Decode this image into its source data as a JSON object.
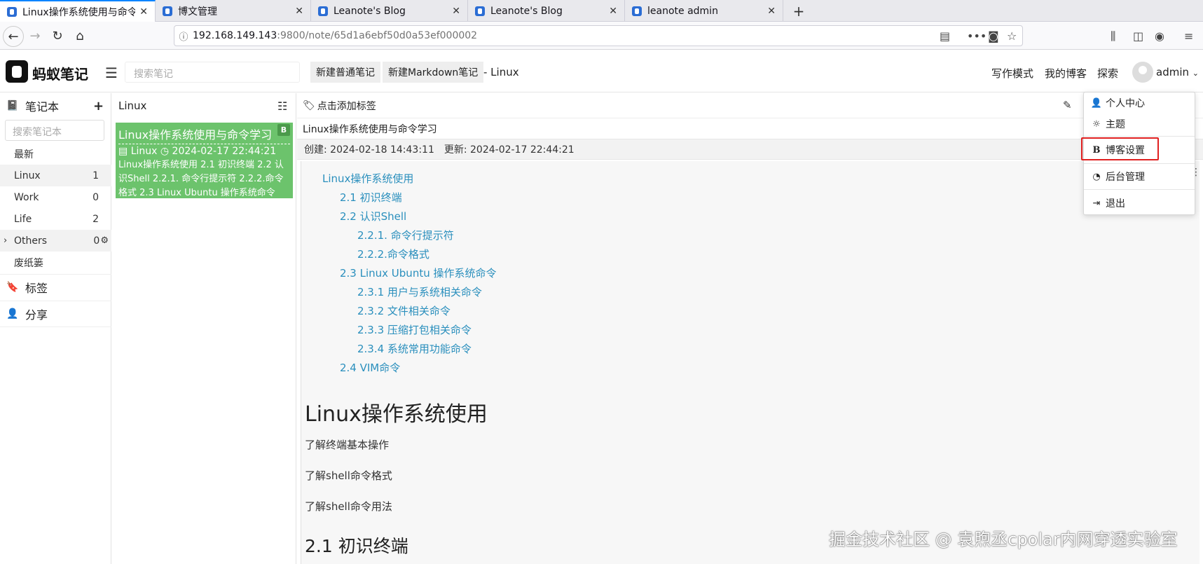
{
  "browser": {
    "tabs": [
      {
        "label": "Linux操作系统使用与命令学习",
        "active": true
      },
      {
        "label": "博文管理",
        "active": false
      },
      {
        "label": "Leanote's Blog",
        "active": false
      },
      {
        "label": "Leanote's Blog",
        "active": false
      },
      {
        "label": "leanote admin",
        "active": false
      }
    ],
    "url_host": "192.168.149.143",
    "url_path": ":9800/note/65d1a6ebf50d0a53ef000002"
  },
  "header": {
    "logo_text": "蚂蚁笔记",
    "search_placeholder": "搜索笔记",
    "new_note": "新建普通笔记",
    "new_markdown": "新建Markdown笔记",
    "current_notebook": "- Linux",
    "links": [
      "写作模式",
      "我的博客",
      "探索"
    ],
    "username": "admin"
  },
  "sidebar": {
    "notebooks_title": "笔记本",
    "search_placeholder": "搜索笔记本",
    "items": [
      {
        "label": "最新",
        "count": ""
      },
      {
        "label": "Linux",
        "count": "1"
      },
      {
        "label": "Work",
        "count": "0"
      },
      {
        "label": "Life",
        "count": "2"
      },
      {
        "label": "Others",
        "count": "0"
      },
      {
        "label": "废纸篓",
        "count": ""
      }
    ],
    "tags_title": "标签",
    "share_title": "分享"
  },
  "notelist": {
    "title": "Linux",
    "note": {
      "title": "Linux操作系统使用与命令学习",
      "notebook": "Linux",
      "time": "2024-02-17 22:44:21",
      "desc": "Linux操作系统使用 2.1 初识终端 2.2 认识Shell 2.2.1. 命令行提示符 2.2.2.命令格式 2.3 Linux Ubuntu 操作系统命令",
      "badge": "B"
    }
  },
  "editor": {
    "add_tag": "点击添加标签",
    "title": "Linux操作系统使用与命令学习",
    "created": "创建: 2024-02-18 14:43:11",
    "updated": "更新: 2024-02-17 22:44:21",
    "toc": [
      "Linux操作系统使用",
      "2.1 初识终端",
      "2.2 认识Shell",
      "2.2.1. 命令行提示符",
      "2.2.2.命令格式",
      "2.3 Linux Ubuntu 操作系统命令",
      "2.3.1 用户与系统相关命令",
      "2.3.2 文件相关命令",
      "2.3.3 压缩打包相关命令",
      "2.3.4 系统常用功能命令",
      "2.4 VIM命令"
    ],
    "h1": "Linux操作系统使用",
    "paragraphs": [
      "了解终端基本操作",
      "了解shell命令格式",
      "了解shell命令用法"
    ],
    "h2": "2.1 初识终端"
  },
  "user_menu": {
    "items": [
      "个人中心",
      "主题",
      "博客设置",
      "后台管理",
      "退出"
    ],
    "highlighted": "博客设置"
  },
  "watermark": "掘金技术社区 @ 袁煦丞cpolar内网穿透实验室",
  "colors": {
    "note_selected": "#6cc36c",
    "link": "#2a8fbd",
    "highlight_border": "#e02020"
  }
}
